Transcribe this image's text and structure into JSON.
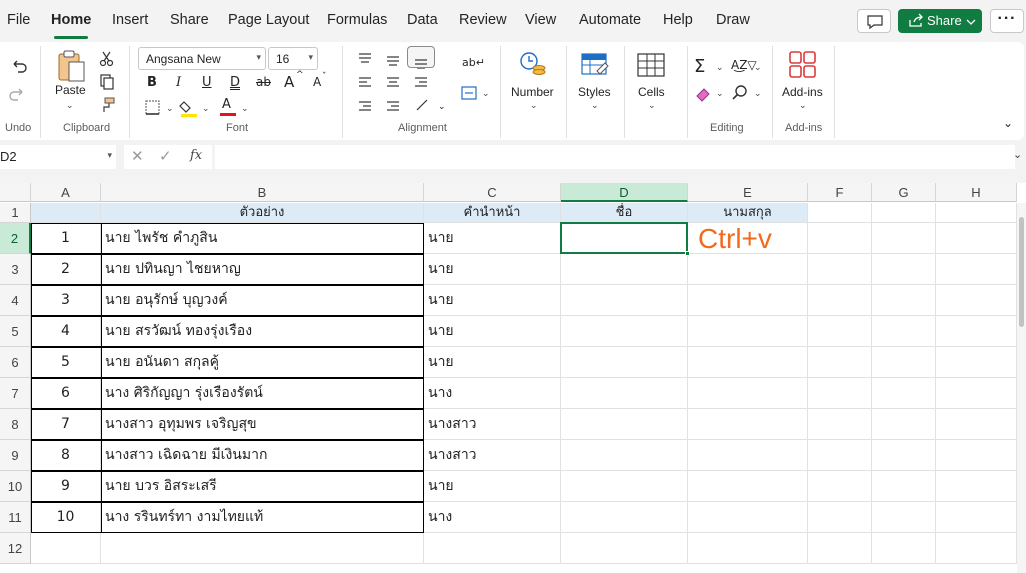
{
  "menu": {
    "items": [
      "File",
      "Home",
      "Insert",
      "Share",
      "Page Layout",
      "Formulas",
      "Data",
      "Review",
      "View",
      "Automate",
      "Help",
      "Draw"
    ],
    "active": "Home",
    "share_label": "Share",
    "more_label": "···"
  },
  "ribbon": {
    "paste_label": "Paste",
    "font_name": "Angsana New",
    "font_size": "16",
    "bold": "B",
    "italic": "I",
    "underline": "U",
    "double_underline": "D",
    "strike": "ab",
    "grow": "A",
    "shrink": "A",
    "font_color_letter": "A",
    "number_label": "Number",
    "styles_label": "Styles",
    "cells_label": "Cells",
    "addins_label": "Add-ins",
    "groups": {
      "undo": "Undo",
      "clipboard": "Clipboard",
      "font": "Font",
      "alignment": "Alignment",
      "editing": "Editing",
      "addins": "Add-ins"
    },
    "accent_color": "#107c41",
    "highlight_color": "#ffe600",
    "font_color": "#e81123"
  },
  "formula_bar": {
    "name_box": "D2",
    "fx_label": "fx",
    "formula": ""
  },
  "sheet": {
    "columns": [
      "A",
      "B",
      "C",
      "D",
      "E",
      "F",
      "G",
      "H"
    ],
    "selected_column": "D",
    "selected_row": "2",
    "rows": [
      "1",
      "2",
      "3",
      "4",
      "5",
      "6",
      "7",
      "8",
      "9",
      "10",
      "11",
      "12"
    ],
    "header_row": {
      "B": "ตัวอย่าง",
      "C": "คำนำหน้า",
      "D": "ชื่อ",
      "E": "นามสกุล"
    },
    "data": [
      {
        "A": "1",
        "B": "นาย ไพรัช คำภูสิน",
        "C": "นาย"
      },
      {
        "A": "2",
        "B": "นาย ปทินญา ไชยหาญ",
        "C": "นาย"
      },
      {
        "A": "3",
        "B": "นาย อนุรักษ์ บุญวงค์",
        "C": "นาย"
      },
      {
        "A": "4",
        "B": "นาย สรวัฒน์ ทองรุ่งเรือง",
        "C": "นาย"
      },
      {
        "A": "5",
        "B": "นาย อนันดา สกุลคู้",
        "C": "นาย"
      },
      {
        "A": "6",
        "B": "นาง ศิริกัญญา รุ่งเรืองรัตน์",
        "C": "นาง"
      },
      {
        "A": "7",
        "B": "นางสาว อุทุมพร เจริญสุข",
        "C": "นางสาว"
      },
      {
        "A": "8",
        "B": "นางสาว เฉิดฉาย มีเงินมาก",
        "C": "นางสาว"
      },
      {
        "A": "9",
        "B": "นาย บวร อิสระเสรี",
        "C": "นาย"
      },
      {
        "A": "10",
        "B": "นาง รรินทร์ทา งามไทยแท้",
        "C": "นาง"
      }
    ],
    "note_text": "Ctrl+v",
    "note_color": "#f26a1b",
    "header_fill": "#ddebf7"
  }
}
